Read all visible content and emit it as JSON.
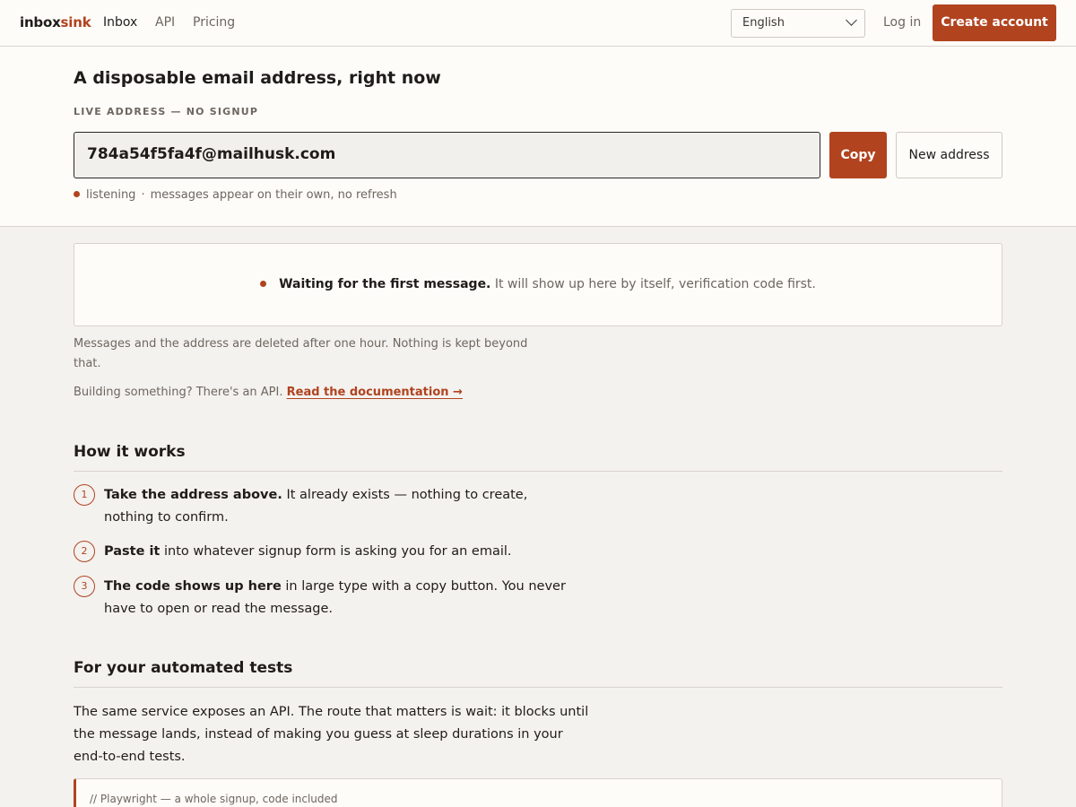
{
  "nav": {
    "logo_main": "inbox",
    "logo_accent": "sink",
    "links": [
      "Inbox",
      "API",
      "Pricing"
    ],
    "language": "English",
    "login": "Log in",
    "create": "Create account"
  },
  "hero": {
    "title": "A disposable email address, right now",
    "kicker": "LIVE ADDRESS — NO SIGNUP",
    "address": "784a54f5fa4f@mailhusk.com",
    "copy": "Copy",
    "new_address": "New address",
    "status": "listening",
    "status_sep": "·",
    "status_note": "messages appear on their own, no refresh"
  },
  "waiting": {
    "strong": "Waiting for the first message.",
    "rest": "It will show up here by itself, verification code first."
  },
  "notes": {
    "retention": "Messages and the address are deleted after one hour. Nothing is kept beyond that.",
    "api_prefix": "Building something? There's an API.",
    "api_link": "Read the documentation →"
  },
  "how": {
    "title": "How it works",
    "steps": [
      {
        "num": "1",
        "strong": "Take the address above.",
        "rest": "It already exists — nothing to create, nothing to confirm."
      },
      {
        "num": "2",
        "strong": "Paste it",
        "rest": "into whatever signup form is asking you for an email."
      },
      {
        "num": "3",
        "strong": "The code shows up here",
        "rest": "in large type with a copy button. You never have to open or read the message."
      }
    ]
  },
  "tests": {
    "title": "For your automated tests",
    "body": "The same service exposes an API. The route that matters is wait: it blocks until the message lands, instead of making you guess at sleep durations in your end-to-end tests.",
    "code_comment": "// Playwright — a whole signup, code included"
  },
  "colors": {
    "accent": "#b1431f",
    "background": "#f4f2ef",
    "surface": "#fdfcf9"
  }
}
